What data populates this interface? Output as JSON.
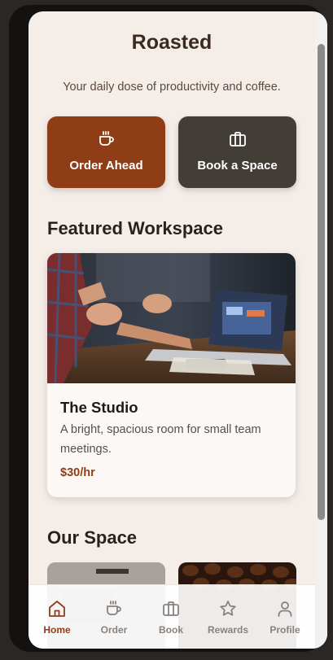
{
  "app": {
    "title": "Roasted",
    "tagline": "Your daily dose of productivity and coffee."
  },
  "actions": {
    "order_label": "Order Ahead",
    "order_icon": "coffee-cup-icon",
    "book_label": "Book a Space",
    "book_icon": "briefcase-icon"
  },
  "featured": {
    "section_title": "Featured Workspace",
    "card": {
      "name": "The Studio",
      "description": "A bright, spacious room for small team meetings.",
      "price": "$30/hr",
      "photo": "people-meeting-with-laptop-photo"
    }
  },
  "our_space": {
    "section_title": "Our Space",
    "thumbs": [
      "office-interior-photo",
      "coffee-beans-photo"
    ]
  },
  "nav": {
    "items": [
      {
        "label": "Home",
        "icon": "home-icon",
        "active": true
      },
      {
        "label": "Order",
        "icon": "coffee-cup-icon",
        "active": false
      },
      {
        "label": "Book",
        "icon": "briefcase-icon",
        "active": false
      },
      {
        "label": "Rewards",
        "icon": "star-icon",
        "active": false
      },
      {
        "label": "Profile",
        "icon": "user-icon",
        "active": false
      }
    ]
  },
  "colors": {
    "accent": "#8f3d17",
    "dark_button": "#433d38",
    "background": "#f5eee8"
  }
}
